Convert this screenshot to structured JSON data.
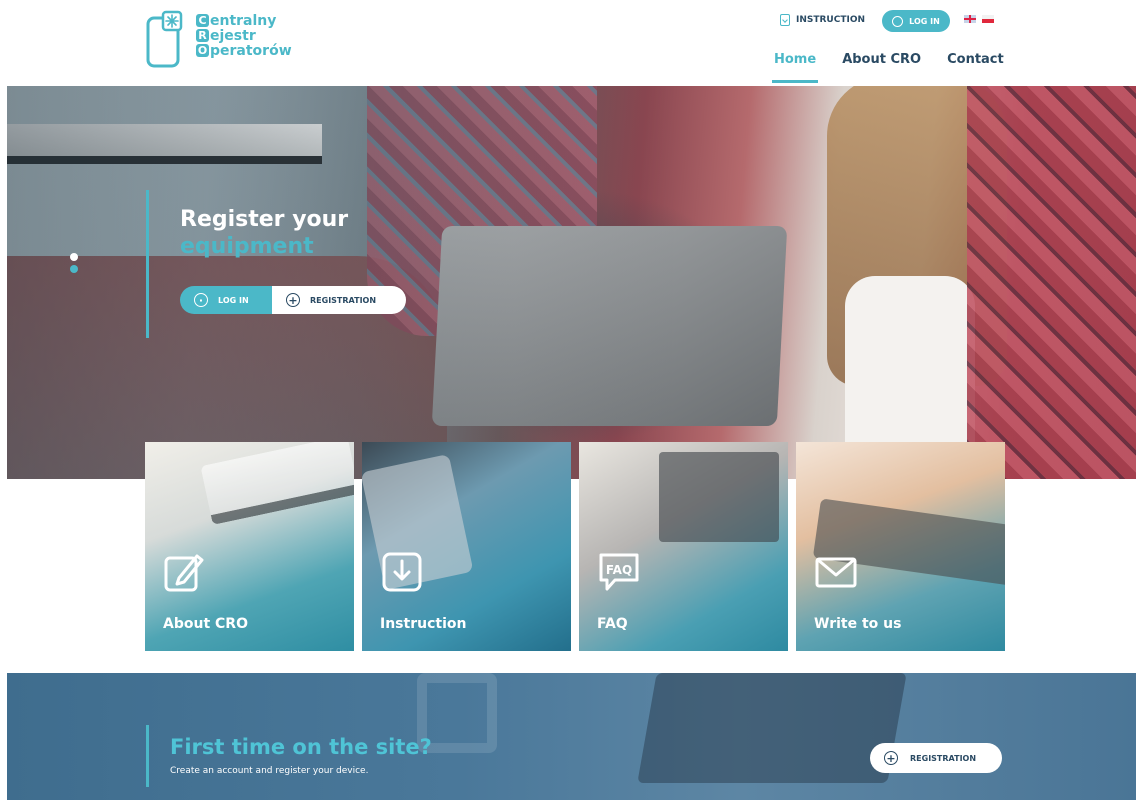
{
  "header": {
    "logo": {
      "line1": "entralny",
      "line2": "ejestr",
      "line3": "peratorów",
      "cap1": "C",
      "cap2": "R",
      "cap3": "O"
    },
    "instruction_label": "INSTRUCTION",
    "login_label": "LOG IN",
    "languages": [
      "en-flag-icon",
      "pl-flag-icon"
    ],
    "nav": [
      {
        "label": "Home",
        "active": true
      },
      {
        "label": "About CRO",
        "active": false
      },
      {
        "label": "Contact",
        "active": false
      }
    ]
  },
  "hero": {
    "title_line1": "Register your",
    "title_line2": "equipment",
    "login_button": "LOG IN",
    "registration_button": "REGISTRATION",
    "slider_dots": 2
  },
  "tiles": [
    {
      "label": "About CRO",
      "icon": "edit-icon"
    },
    {
      "label": "Instruction",
      "icon": "download-icon"
    },
    {
      "label": "FAQ",
      "icon": "faq-bubble-icon",
      "icon_text": "FAQ"
    },
    {
      "label": "Write to us",
      "icon": "envelope-icon"
    }
  ],
  "banner": {
    "title": "First time on the site?",
    "subtitle": "Create an account and register your device.",
    "registration_button": "REGISTRATION"
  },
  "colors": {
    "accent": "#4bb8c8",
    "navy": "#2a4a63",
    "banner": "#4a789a"
  }
}
